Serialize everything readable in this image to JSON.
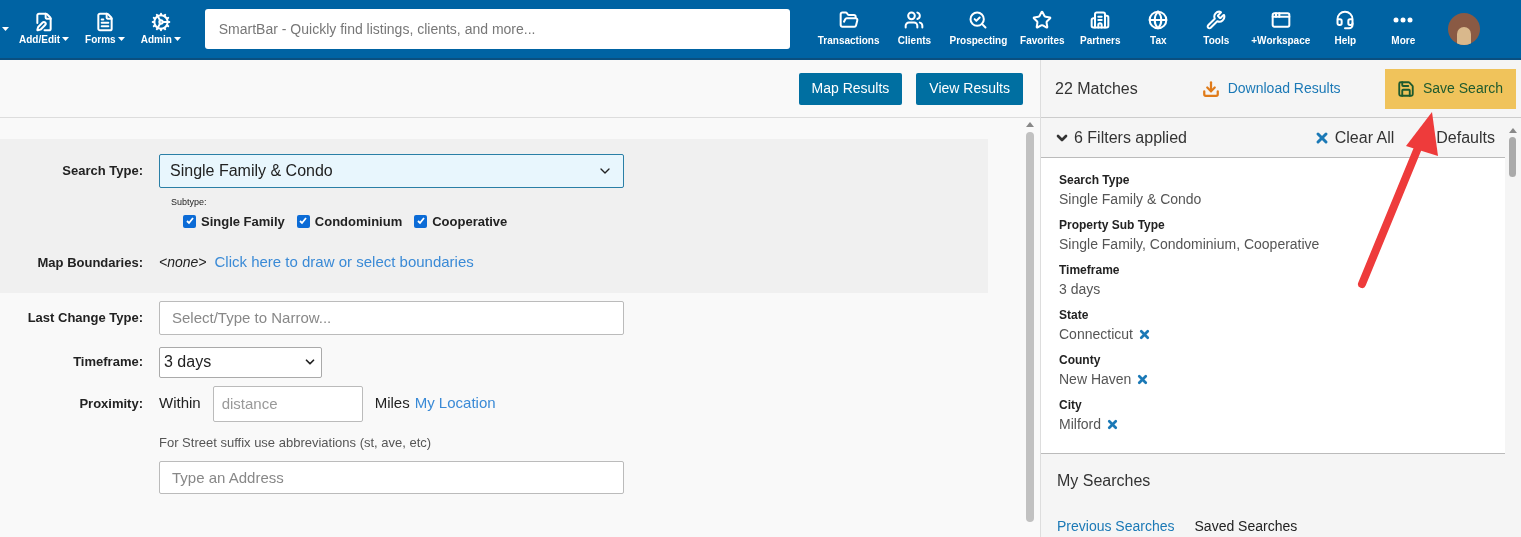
{
  "nav": {
    "menus": [
      {
        "label": "Add/Edit"
      },
      {
        "label": "Forms"
      },
      {
        "label": "Admin"
      }
    ],
    "search": {
      "placeholder": "SmartBar - Quickly find listings, clients, and more..."
    },
    "items": [
      {
        "label": "Transactions"
      },
      {
        "label": "Clients"
      },
      {
        "label": "Prospecting"
      },
      {
        "label": "Favorites"
      },
      {
        "label": "Partners"
      },
      {
        "label": "Tax"
      },
      {
        "label": "Tools"
      },
      {
        "label": "+Workspace"
      },
      {
        "label": "Help"
      },
      {
        "label": "More"
      }
    ]
  },
  "toolbar": {
    "buttons": [
      "Map Results",
      "View Results"
    ]
  },
  "form": {
    "search_type": {
      "label": "Search Type:",
      "value": "Single Family & Condo"
    },
    "subtype": {
      "label": "Subtype:",
      "options": [
        {
          "label": "Single Family",
          "checked": true
        },
        {
          "label": "Condominium",
          "checked": true
        },
        {
          "label": "Cooperative",
          "checked": true
        }
      ]
    },
    "map_boundaries": {
      "label": "Map Boundaries:",
      "value": "<none>",
      "link": "Click here to draw or select boundaries"
    },
    "last_change_type": {
      "label": "Last Change Type:",
      "placeholder": "Select/Type to Narrow..."
    },
    "timeframe": {
      "label": "Timeframe:",
      "value": "3 days"
    },
    "proximity": {
      "label": "Proximity:",
      "within": "Within",
      "placeholder": "distance",
      "miles": "Miles",
      "link": "My Location",
      "hint": "For Street suffix use abbreviations (st, ave, etc)",
      "address_placeholder": "Type an Address"
    }
  },
  "results": {
    "matches": "22 Matches",
    "download": "Download Results",
    "save": "Save Search",
    "filters_title": "6 Filters applied",
    "clear_all": "Clear All",
    "defaults": "Defaults",
    "filters": [
      {
        "name": "Search Type",
        "value": "Single Family & Condo",
        "removable": false
      },
      {
        "name": "Property Sub Type",
        "value": "Single Family, Condominium, Cooperative",
        "removable": false
      },
      {
        "name": "Timeframe",
        "value": "3 days",
        "removable": false
      },
      {
        "name": "State",
        "value": "Connecticut",
        "removable": true
      },
      {
        "name": "County",
        "value": "New Haven",
        "removable": true
      },
      {
        "name": "City",
        "value": "Milford",
        "removable": true
      }
    ],
    "my_searches": {
      "title": "My Searches",
      "tabs": [
        {
          "label": "Previous Searches",
          "selected": false
        },
        {
          "label": "Saved Searches",
          "selected": true
        }
      ]
    }
  }
}
